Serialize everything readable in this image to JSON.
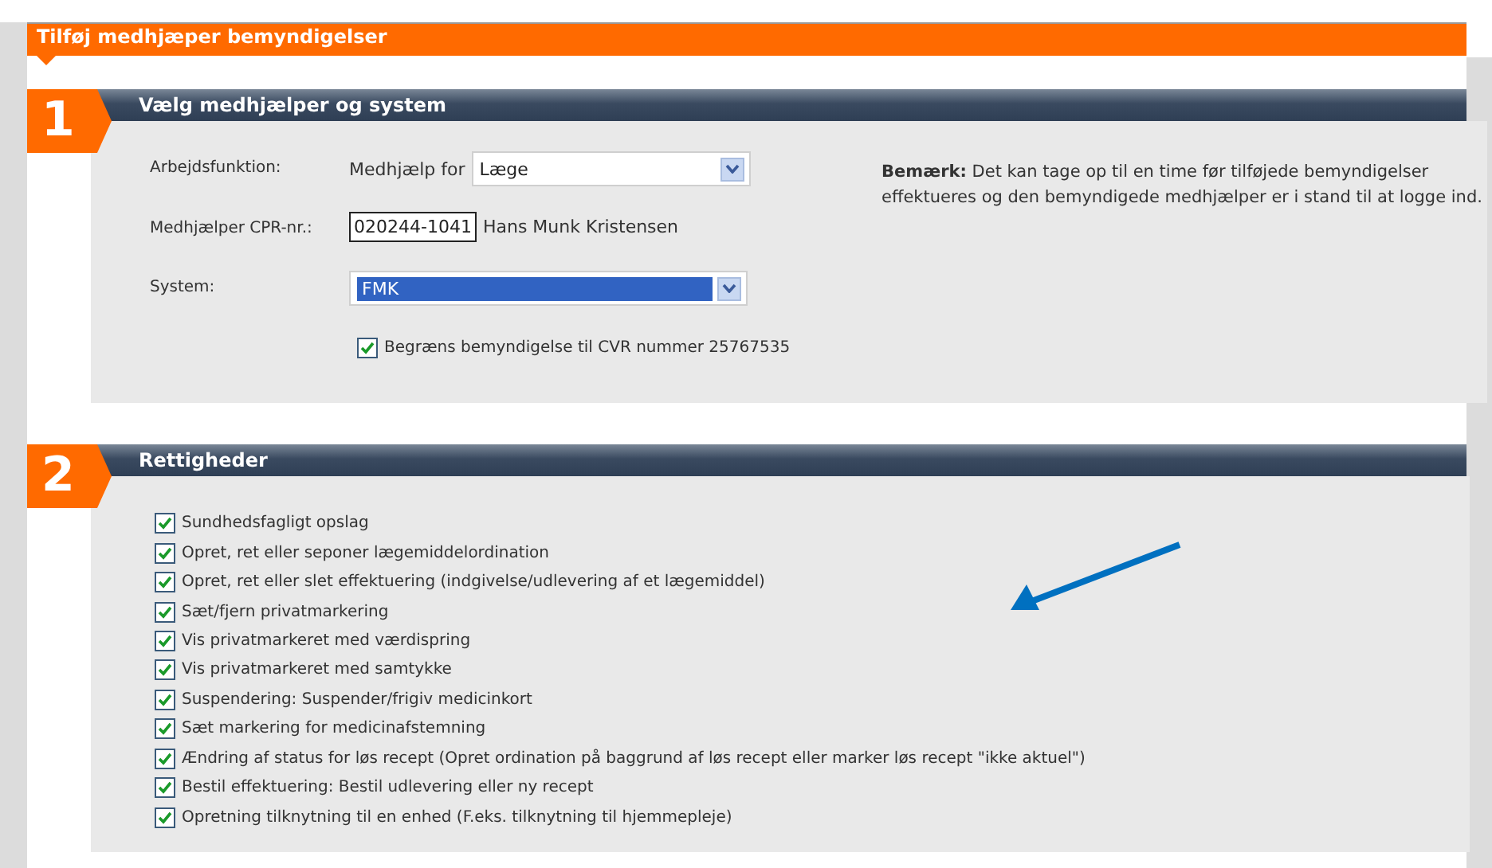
{
  "page_title": "Tilføj medhjæper bemyndigelser",
  "section_1": {
    "number": "1",
    "title": "Vælg medhjælper og system",
    "work_function": {
      "label": "Arbejdsfunktion:",
      "prefix": "Medhjælp for",
      "value": "Læge"
    },
    "cpr": {
      "label": "Medhjælper CPR-nr.:",
      "value": "020244-1041",
      "name": "Hans Munk Kristensen"
    },
    "system": {
      "label": "System:",
      "value": "FMK"
    },
    "limit_cvr": {
      "label": "Begræns bemyndigelse til CVR nummer 25767535",
      "checked": true
    },
    "note": "**Bemærk:** Det kan tage op til en time før tilføjede bemyndigelser effektueres og den bemyndigede medhjælper er i stand til at logge ind."
  },
  "section_2": {
    "number": "2",
    "title": "Rettigheder",
    "rights": [
      {
        "label": "Sundhedsfagligt opslag",
        "checked": true
      },
      {
        "label": "Opret, ret eller seponer lægemiddelordination",
        "checked": true
      },
      {
        "label": "Opret, ret eller slet effektuering (indgivelse/udlevering af et lægemiddel)",
        "checked": true
      },
      {
        "label": "Sæt/fjern privatmarkering",
        "checked": true
      },
      {
        "label": "Vis privatmarkeret med værdispring",
        "checked": true
      },
      {
        "label": "Vis privatmarkeret med samtykke",
        "checked": true
      },
      {
        "label": "Suspendering: Suspender/frigiv medicinkort",
        "checked": true
      },
      {
        "label": "Sæt markering for medicinafstemning",
        "checked": true
      },
      {
        "label": "Ændring af status for løs recept (Opret ordination på baggrund af løs recept eller marker løs recept \"ikke aktuel\")",
        "checked": true
      },
      {
        "label": "Bestil effektuering: Bestil udlevering eller ny recept",
        "checked": true
      },
      {
        "label": "Opretning tilknytning til en enhed (F.eks. tilknytning til hjemmepleje)",
        "checked": true
      }
    ]
  }
}
